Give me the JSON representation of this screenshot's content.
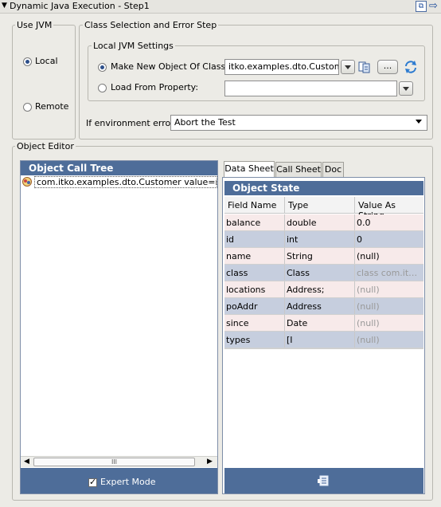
{
  "titlebar": {
    "title": "Dynamic Java Execution - Step1"
  },
  "use_jvm": {
    "legend": "Use JVM",
    "local_label": "Local",
    "remote_label": "Remote"
  },
  "class_selection": {
    "legend": "Class Selection and Error Step",
    "local_settings_legend": "Local JVM Settings",
    "make_new_label": "Make New Object Of Class:",
    "make_new_value": "itko.examples.dto.Customer",
    "browse_label": "...",
    "load_from_label": "Load From Property:",
    "load_from_value": "",
    "env_error_label": "If environment error:",
    "env_error_value": "Abort the Test"
  },
  "object_editor": {
    "legend": "Object Editor",
    "call_tree_title": "Object Call Tree",
    "tree_item": "com.itko.examples.dto.Customer value=null no",
    "scroll_thumb": "III",
    "expert_mode_label": "Expert Mode"
  },
  "tabs": [
    "Data Sheet",
    "Call Sheet",
    "Doc"
  ],
  "object_state": {
    "title": "Object State",
    "columns": [
      "Field Name",
      "Type",
      "Value As String"
    ],
    "rows": [
      {
        "field": "balance",
        "type": "double",
        "value": "0.0",
        "muted": false
      },
      {
        "field": "id",
        "type": "int",
        "value": "0",
        "muted": false
      },
      {
        "field": "name",
        "type": "String",
        "value": "(null)",
        "muted": false
      },
      {
        "field": "class",
        "type": "Class",
        "value": "class com.itko....",
        "muted": true
      },
      {
        "field": "locations",
        "type": "Address;",
        "value": "(null)",
        "muted": true
      },
      {
        "field": "poAddr",
        "type": "Address",
        "value": "(null)",
        "muted": true
      },
      {
        "field": "since",
        "type": "Date",
        "value": "(null)",
        "muted": true
      },
      {
        "field": "types",
        "type": "[I",
        "value": "(null)",
        "muted": true
      }
    ]
  },
  "icons": {
    "collapse": "triangle-down-icon",
    "dock": "dock-icon",
    "arrow": "arrow-right-icon",
    "class_browser": "class-browser-icon",
    "refresh": "refresh-icon",
    "tree_node": "object-node-icon",
    "footer_tool": "list-tool-icon"
  },
  "colors": {
    "panel_header": "#4e6d99",
    "row_even": "#f7eaea",
    "row_odd": "#c6cede"
  }
}
